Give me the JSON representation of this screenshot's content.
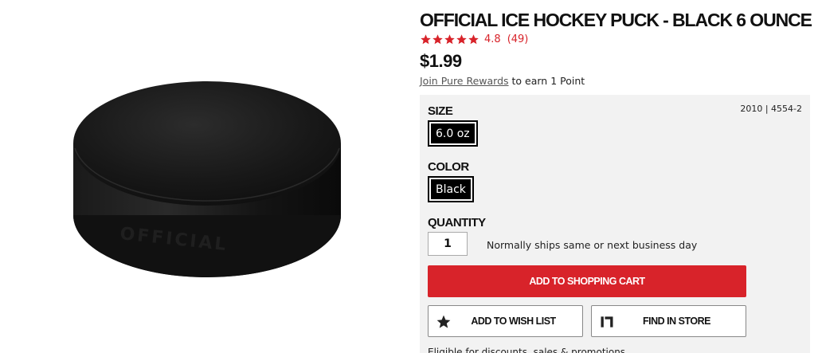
{
  "product": {
    "image_alt": "Official ice hockey puck",
    "puck_text": "OFFICIAL",
    "title": "OFFICIAL ICE HOCKEY PUCK - BLACK 6 OUNCE",
    "rating": {
      "stars": 5,
      "value": "4.8",
      "count": "(49)"
    },
    "price": "$1.99",
    "rewards": {
      "link": "Join Pure Rewards",
      "suffix": " to earn 1 Point"
    }
  },
  "options": {
    "sku": "2010 | 4554-2",
    "size_label": "SIZE",
    "size_value": "6.0 oz",
    "color_label": "COLOR",
    "color_value": "Black",
    "quantity_label": "QUANTITY",
    "quantity_value": "1",
    "shipping_note": "Normally ships same or next business day"
  },
  "actions": {
    "add_to_cart": "ADD TO SHOPPING CART",
    "wishlist": "ADD TO WISH LIST",
    "find_store": "FIND IN STORE"
  },
  "footer_note": "Eligible for discounts, sales & promotions",
  "colors": {
    "accent_red": "#d8232a",
    "panel_bg": "#f2f2f2",
    "swatch_bg": "#000000"
  },
  "icons": {
    "rating": "star-icon",
    "wishlist": "star-icon",
    "store": "store-icon"
  }
}
